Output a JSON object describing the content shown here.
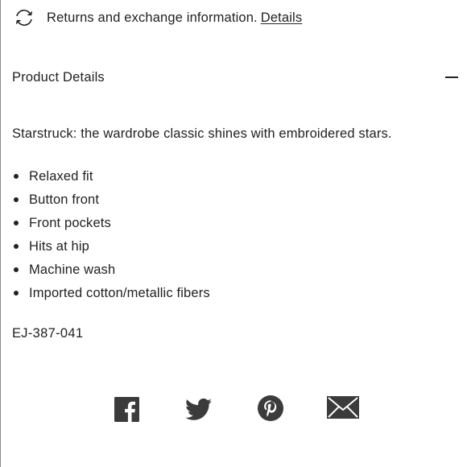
{
  "returns": {
    "icon": "refresh-cycle-icon",
    "text": "Returns and exchange information.",
    "link": "Details"
  },
  "product_details": {
    "title": "Product Details",
    "toggle_icon": "minus-collapse-icon",
    "description": "Starstruck: the wardrobe classic shines with embroidered stars.",
    "features": [
      "Relaxed fit",
      "Button front",
      "Front pockets",
      "Hits at hip",
      "Machine wash",
      "Imported cotton/metallic fibers"
    ],
    "sku": "EJ-387-041"
  },
  "share": {
    "icons": [
      "facebook-icon",
      "twitter-icon",
      "pinterest-icon",
      "email-icon"
    ],
    "color": "#3b3b3b"
  }
}
